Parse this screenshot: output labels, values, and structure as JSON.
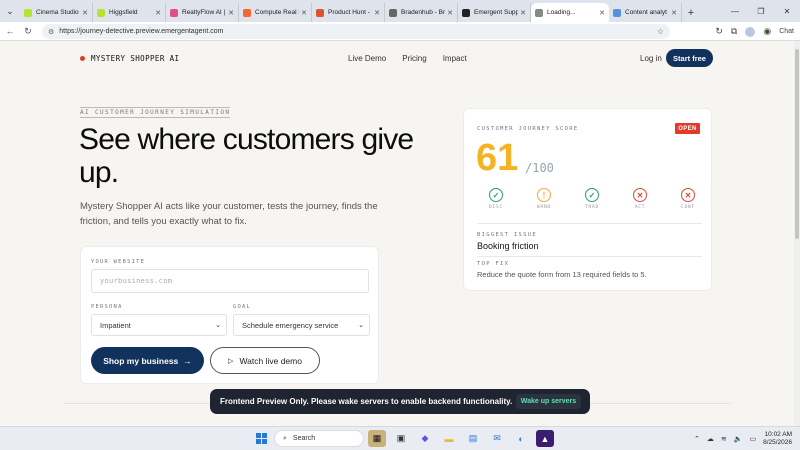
{
  "browser": {
    "tabs": [
      {
        "label": "Cinema Studio -",
        "color": "#b6e234",
        "active": false
      },
      {
        "label": "Higgsfield",
        "color": "#b6e234",
        "active": false
      },
      {
        "label": "RealtyFlow AI |",
        "color": "#e04e8a",
        "active": false
      },
      {
        "label": "Compute Real L",
        "color": "#f06a30",
        "active": false
      },
      {
        "label": "Product Hunt -",
        "color": "#da552f",
        "active": false
      },
      {
        "label": "Bradenhub - Bro",
        "color": "#666666",
        "active": false
      },
      {
        "label": "Emergent Supp",
        "color": "#222222",
        "active": false
      },
      {
        "label": "Loading...",
        "color": "#888888",
        "active": true
      },
      {
        "label": "Content analyt",
        "color": "#5a8fe0",
        "active": false
      }
    ],
    "url": "https://journey-detective.preview.emergentagent.com",
    "chat_label": "Chat"
  },
  "nav": {
    "brand": "MYSTERY SHOPPER AI",
    "links": [
      "Live Demo",
      "Pricing",
      "Impact"
    ],
    "login": "Log in",
    "start_free": "Start free"
  },
  "hero": {
    "eyebrow": "AI CUSTOMER JOURNEY SIMULATION",
    "title": "See where customers give up.",
    "description": "Mystery Shopper AI acts like your customer, tests the journey, finds the friction, and tells you exactly what to fix."
  },
  "form": {
    "website_label": "YOUR WEBSITE",
    "website_placeholder": "yourbusiness.com",
    "persona_label": "PERSONA",
    "persona_value": "Impatient",
    "goal_label": "GOAL",
    "goal_value": "Schedule emergency service",
    "shop_button": "Shop my business",
    "demo_button": "Watch live demo"
  },
  "score": {
    "label": "CUSTOMER JOURNEY SCORE",
    "badge": "OPEN",
    "value": "61",
    "max": "/100",
    "stages": [
      {
        "name": "DISC",
        "status": "check",
        "color": "#2e9e63"
      },
      {
        "name": "WAND",
        "status": "warn",
        "color": "#f0a93a"
      },
      {
        "name": "TRAD",
        "status": "check",
        "color": "#2e9e63"
      },
      {
        "name": "ACT",
        "status": "fail",
        "color": "#e0463a"
      },
      {
        "name": "CONF",
        "status": "fail",
        "color": "#e0463a"
      }
    ],
    "biggest_issue_label": "BIGGEST ISSUE",
    "biggest_issue": "Booking friction",
    "top_fix_label": "TOP FIX",
    "top_fix": "Reduce the quote form from 13 required fields to 5."
  },
  "toast": {
    "message": "Frontend Preview Only. Please wake servers to enable backend functionality.",
    "button": "Wake up servers"
  },
  "taskbar": {
    "search": "Search",
    "time": "10:02 AM",
    "date": "8/25/2026"
  }
}
